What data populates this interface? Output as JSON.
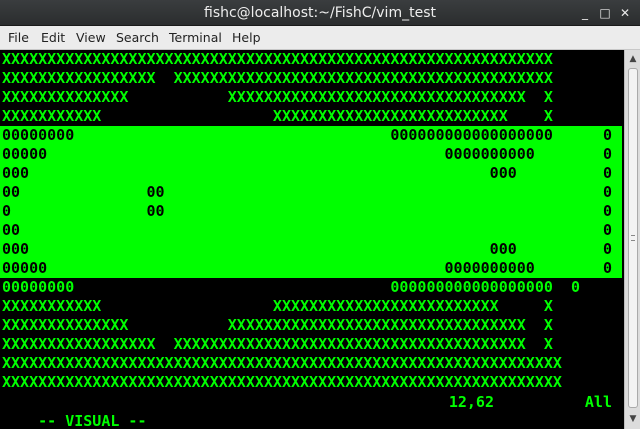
{
  "window": {
    "title": "fishc@localhost:~/FishC/vim_test",
    "minimize_glyph": "_",
    "maximize_glyph": "□",
    "close_glyph": "✕"
  },
  "menu": {
    "file": "File",
    "edit": "Edit",
    "view": "View",
    "search": "Search",
    "terminal": "Terminal",
    "help": "Help"
  },
  "terminal": {
    "lines_top": [
      "XXXXXXXXXXXXXXXXXXXXXXXXXXXXXXXXXXXXXXXXXXXXXXXXXXXXXXXXXXXXX",
      "XXXXXXXXXXXXXXXXX  XXXXXXXXXXXXXXXXXXXXXXXXXXXXXXXXXXXXXXXXXX",
      "XXXXXXXXXXXXXX           XXXXXXXXXXXXXXXXXXXXXXXXXXXXXXXXX  X",
      "XXXXXXXXXXX                   XXXXXXXXXXXXXXXXXXXXXXXXXX    X"
    ],
    "lines_selected": [
      "00000000                                   000000000000000000",
      "00000                                            0000000000",
      "000                                                   000",
      "00              00",
      "0               00",
      "00",
      "000                                                   000",
      "00000                                            0000000000"
    ],
    "selected_right_char": "0",
    "lines_bottom": [
      "00000000                                   000000000000000000  0",
      "XXXXXXXXXXX                   XXXXXXXXXXXXXXXXXXXXXXXXX     X",
      "XXXXXXXXXXXXXX           XXXXXXXXXXXXXXXXXXXXXXXXXXXXXXXXX  X",
      "XXXXXXXXXXXXXXXXX  XXXXXXXXXXXXXXXXXXXXXXXXXXXXXXXXXXXXXXX  X",
      "XXXXXXXXXXXXXXXXXXXXXXXXXXXXXXXXXXXXXXXXXXXXXXXXXXXXXXXXXXXXXX",
      "XXXXXXXXXXXXXXXXXXXXXXXXXXXXXXXXXXXXXXXXXXXXXXXXXXXXXXXXXXXXXX"
    ],
    "status_mode": "-- VISUAL --",
    "status_position": "12,62",
    "status_scroll": "All"
  },
  "colors": {
    "terminal_fg": "#00ff00",
    "terminal_bg": "#000000",
    "selection_bg": "#00ff00",
    "selection_fg": "#000000"
  },
  "icons": {
    "scroll_up": "scroll-up-arrow-icon",
    "scroll_down": "scroll-down-arrow-icon"
  }
}
